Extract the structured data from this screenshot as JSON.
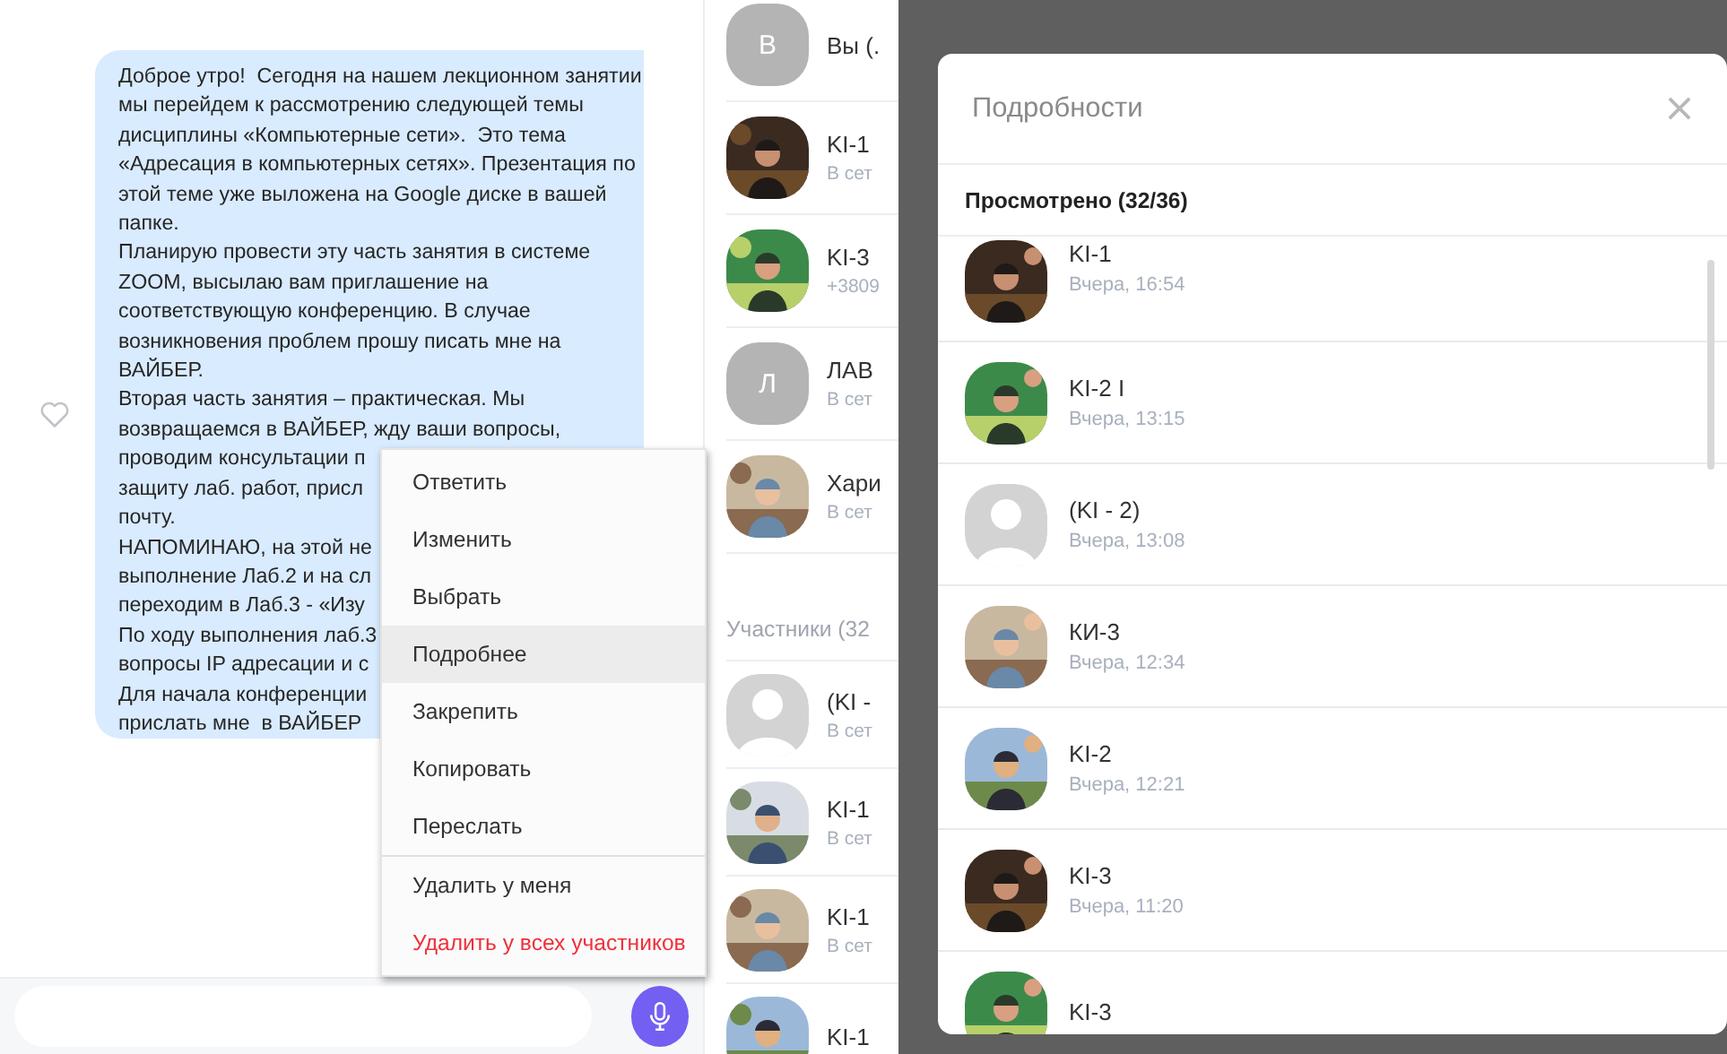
{
  "chat": {
    "message_lines": [
      "Доброе утро!  Сегодня на нашем лекционном занятии",
      "мы перейдем к рассмотрению следующей темы",
      "дисциплины «Компьютерные сети».  Это тема",
      "«Адресация в компьютерных сетях». Презентация по",
      "этой теме уже выложена на Google диске в вашей",
      "папке.",
      "Планирую провести эту часть занятия в системе",
      "ZOOM, высылаю вам приглашение на",
      "соответствующую конференцию. В случае",
      "возникновения проблем прошу писать мне на",
      "ВАЙБЕР.",
      "Вторая часть занятия – практическая. Мы",
      "возвращаемся в ВАЙБЕР, жду ваши вопросы,",
      "проводим консультации п",
      "защиту лаб. работ, присл",
      "почту.",
      "НАПОМИНАЮ, на этой не",
      "выполнение Лаб.2 и на сл",
      "переходим в Лаб.3 - «Изу",
      "По ходу выполнения лаб.3",
      "вопросы IP адресации и с",
      "Для начала конференции",
      "прислать мне  в ВАЙБЕР"
    ]
  },
  "context_menu": [
    {
      "label": "Ответить",
      "selected": false,
      "kind": "normal",
      "divider_before": false
    },
    {
      "label": "Изменить",
      "selected": false,
      "kind": "normal",
      "divider_before": false
    },
    {
      "label": "Выбрать",
      "selected": false,
      "kind": "normal",
      "divider_before": false
    },
    {
      "label": "Подробнее",
      "selected": true,
      "kind": "normal",
      "divider_before": false
    },
    {
      "label": "Закрепить",
      "selected": false,
      "kind": "normal",
      "divider_before": false
    },
    {
      "label": "Копировать",
      "selected": false,
      "kind": "normal",
      "divider_before": false
    },
    {
      "label": "Переслать",
      "selected": false,
      "kind": "normal",
      "divider_before": false
    },
    {
      "label": "Удалить у меня",
      "selected": false,
      "kind": "normal",
      "divider_before": true
    },
    {
      "label": "Удалить у всех участников",
      "selected": false,
      "kind": "danger",
      "divider_before": false
    }
  ],
  "members": {
    "admins": [
      {
        "name": "Вы (.",
        "avatar": {
          "kind": "letter",
          "letter": "В"
        }
      },
      {
        "name": "KI-1",
        "status": "В сет"
      },
      {
        "name": "KI-3",
        "status": "+3809"
      },
      {
        "name": "ЛАВ",
        "status": "В сет",
        "avatar": {
          "kind": "letter",
          "letter": "Л"
        }
      },
      {
        "name": "Хари",
        "status": "В сет"
      }
    ],
    "section_title": "Участники (32",
    "participants": [
      {
        "name": "(KI -",
        "status": "В сет",
        "avatar": {
          "kind": "default"
        }
      },
      {
        "name": "KI-1",
        "status": "В сет"
      },
      {
        "name": "KI-1",
        "status": "В сет"
      },
      {
        "name": "KI-1"
      }
    ]
  },
  "details": {
    "title": "Подробности",
    "section_title": "Просмотрено (32/36)",
    "viewers": [
      {
        "name": "KI-1",
        "time": "Вчера, 16:54"
      },
      {
        "name": "KI-2 I",
        "time": "Вчера, 13:15"
      },
      {
        "name": "(KI - 2)",
        "time": "Вчера, 13:08",
        "avatar": {
          "kind": "default"
        }
      },
      {
        "name": "КИ-3",
        "time": "Вчера, 12:34"
      },
      {
        "name": "KI-2",
        "time": "Вчера, 12:21"
      },
      {
        "name": "KI-3",
        "time": "Вчера, 11:20"
      },
      {
        "name": "KI-3"
      }
    ]
  }
}
